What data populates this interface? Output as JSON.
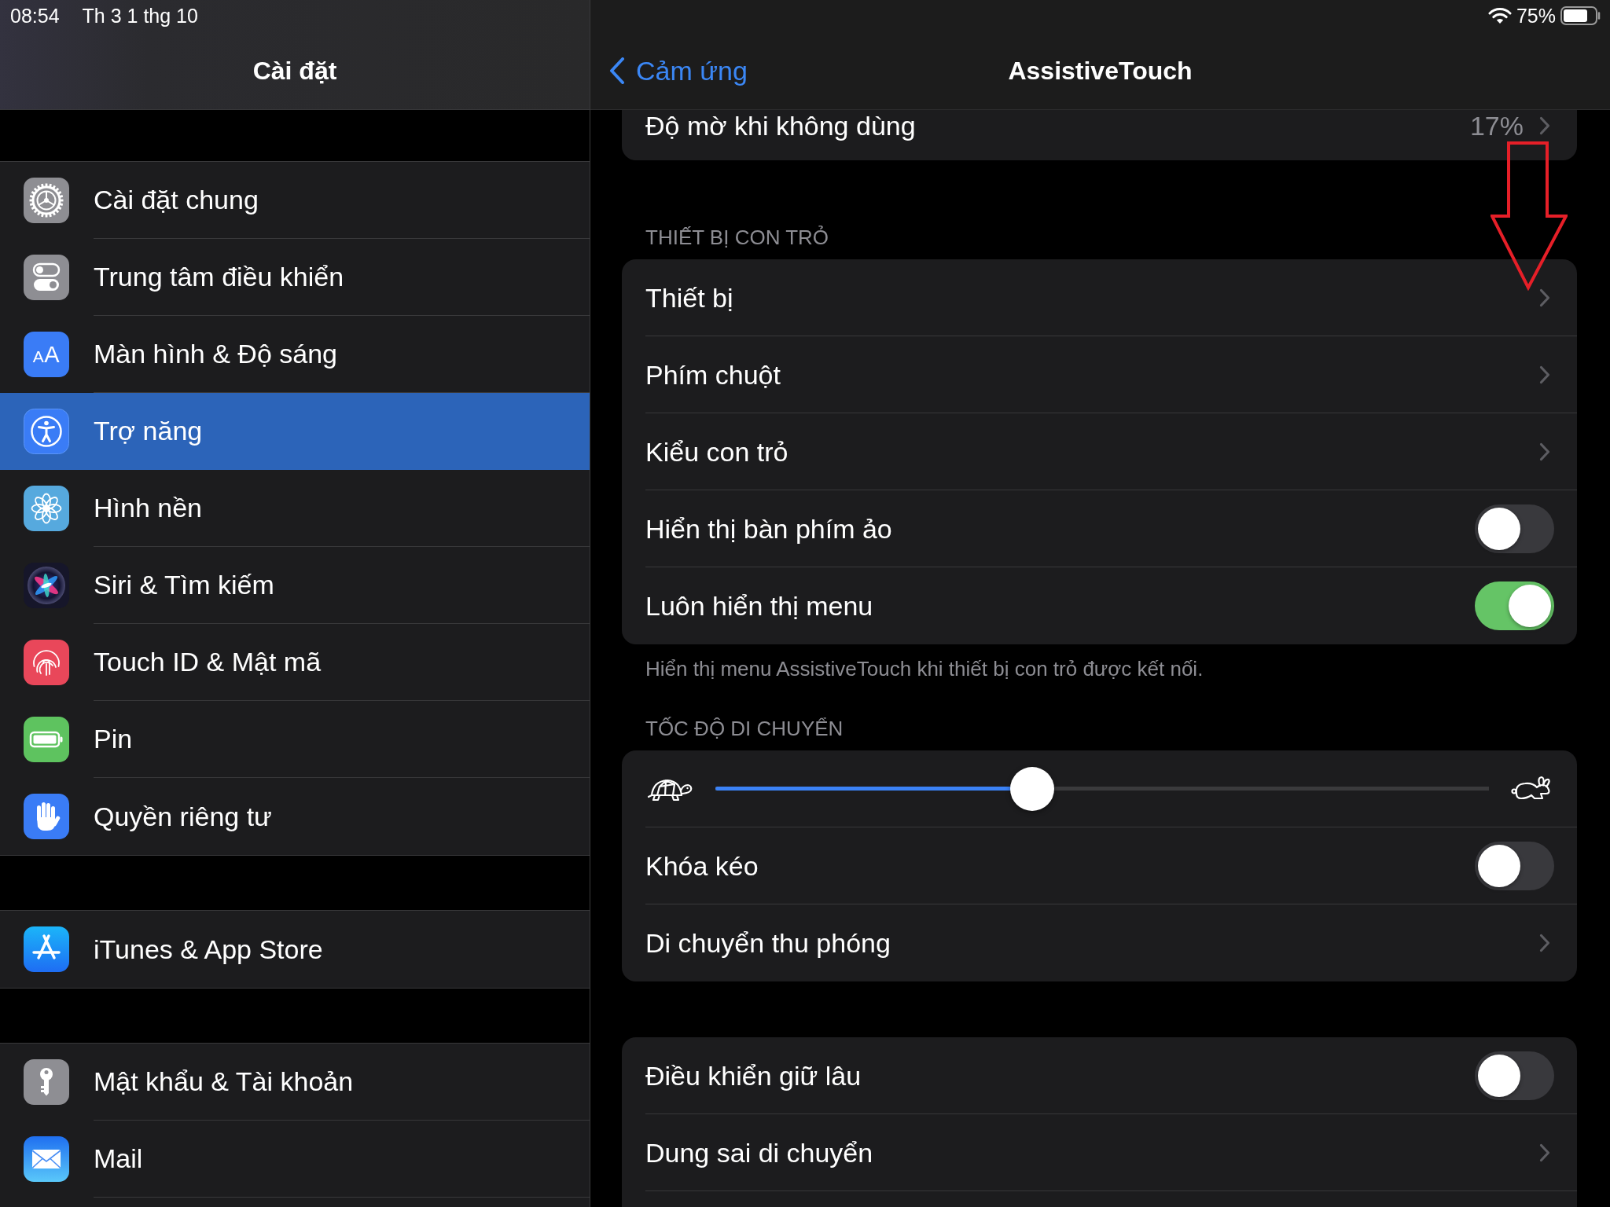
{
  "status_bar": {
    "time": "08:54",
    "date": "Th 3 1 thg 10",
    "battery": "75%"
  },
  "sidebar": {
    "title": "Cài đặt",
    "groups": [
      {
        "items": [
          {
            "label": "Cài đặt chung",
            "selected": false
          },
          {
            "label": "Trung tâm điều khiển",
            "selected": false
          },
          {
            "label": "Màn hình & Độ sáng",
            "icon_text": "AA",
            "selected": false
          },
          {
            "label": "Trợ năng",
            "selected": true
          },
          {
            "label": "Hình nền",
            "selected": false
          },
          {
            "label": "Siri & Tìm kiếm",
            "selected": false
          },
          {
            "label": "Touch ID & Mật mã",
            "selected": false
          },
          {
            "label": "Pin",
            "selected": false
          },
          {
            "label": "Quyền riêng tư",
            "selected": false
          }
        ]
      },
      {
        "items": [
          {
            "label": "iTunes & App Store",
            "selected": false
          }
        ]
      },
      {
        "items": [
          {
            "label": "Mật khẩu & Tài khoản",
            "selected": false
          },
          {
            "label": "Mail",
            "selected": false
          }
        ]
      }
    ]
  },
  "detail": {
    "back_label": "Cảm ứng",
    "title": "AssistiveTouch",
    "groups": [
      {
        "rows": [
          {
            "kind": "value",
            "label": "Độ mờ khi không dùng",
            "value": "17%"
          }
        ]
      },
      {
        "header": "THIẾT BỊ CON TRỎ",
        "rows": [
          {
            "kind": "link",
            "label": "Thiết bị"
          },
          {
            "kind": "link",
            "label": "Phím chuột"
          },
          {
            "kind": "link",
            "label": "Kiểu con trỏ"
          },
          {
            "kind": "toggle",
            "label": "Hiển thị bàn phím ảo",
            "on": false
          },
          {
            "kind": "toggle",
            "label": "Luôn hiển thị menu",
            "on": true
          }
        ],
        "footer": "Hiển thị menu AssistiveTouch khi thiết bị con trỏ được kết nối."
      },
      {
        "header": "TỐC ĐỘ DI CHUYỂN",
        "rows": [
          {
            "kind": "slider",
            "level": 0.41
          },
          {
            "kind": "toggle",
            "label": "Khóa kéo",
            "on": false
          },
          {
            "kind": "link",
            "label": "Di chuyển thu phóng"
          }
        ]
      },
      {
        "rows": [
          {
            "kind": "toggle",
            "label": "Điều khiển giữ lâu",
            "on": false
          },
          {
            "kind": "link",
            "label": "Dung sai di chuyển"
          }
        ]
      }
    ]
  }
}
